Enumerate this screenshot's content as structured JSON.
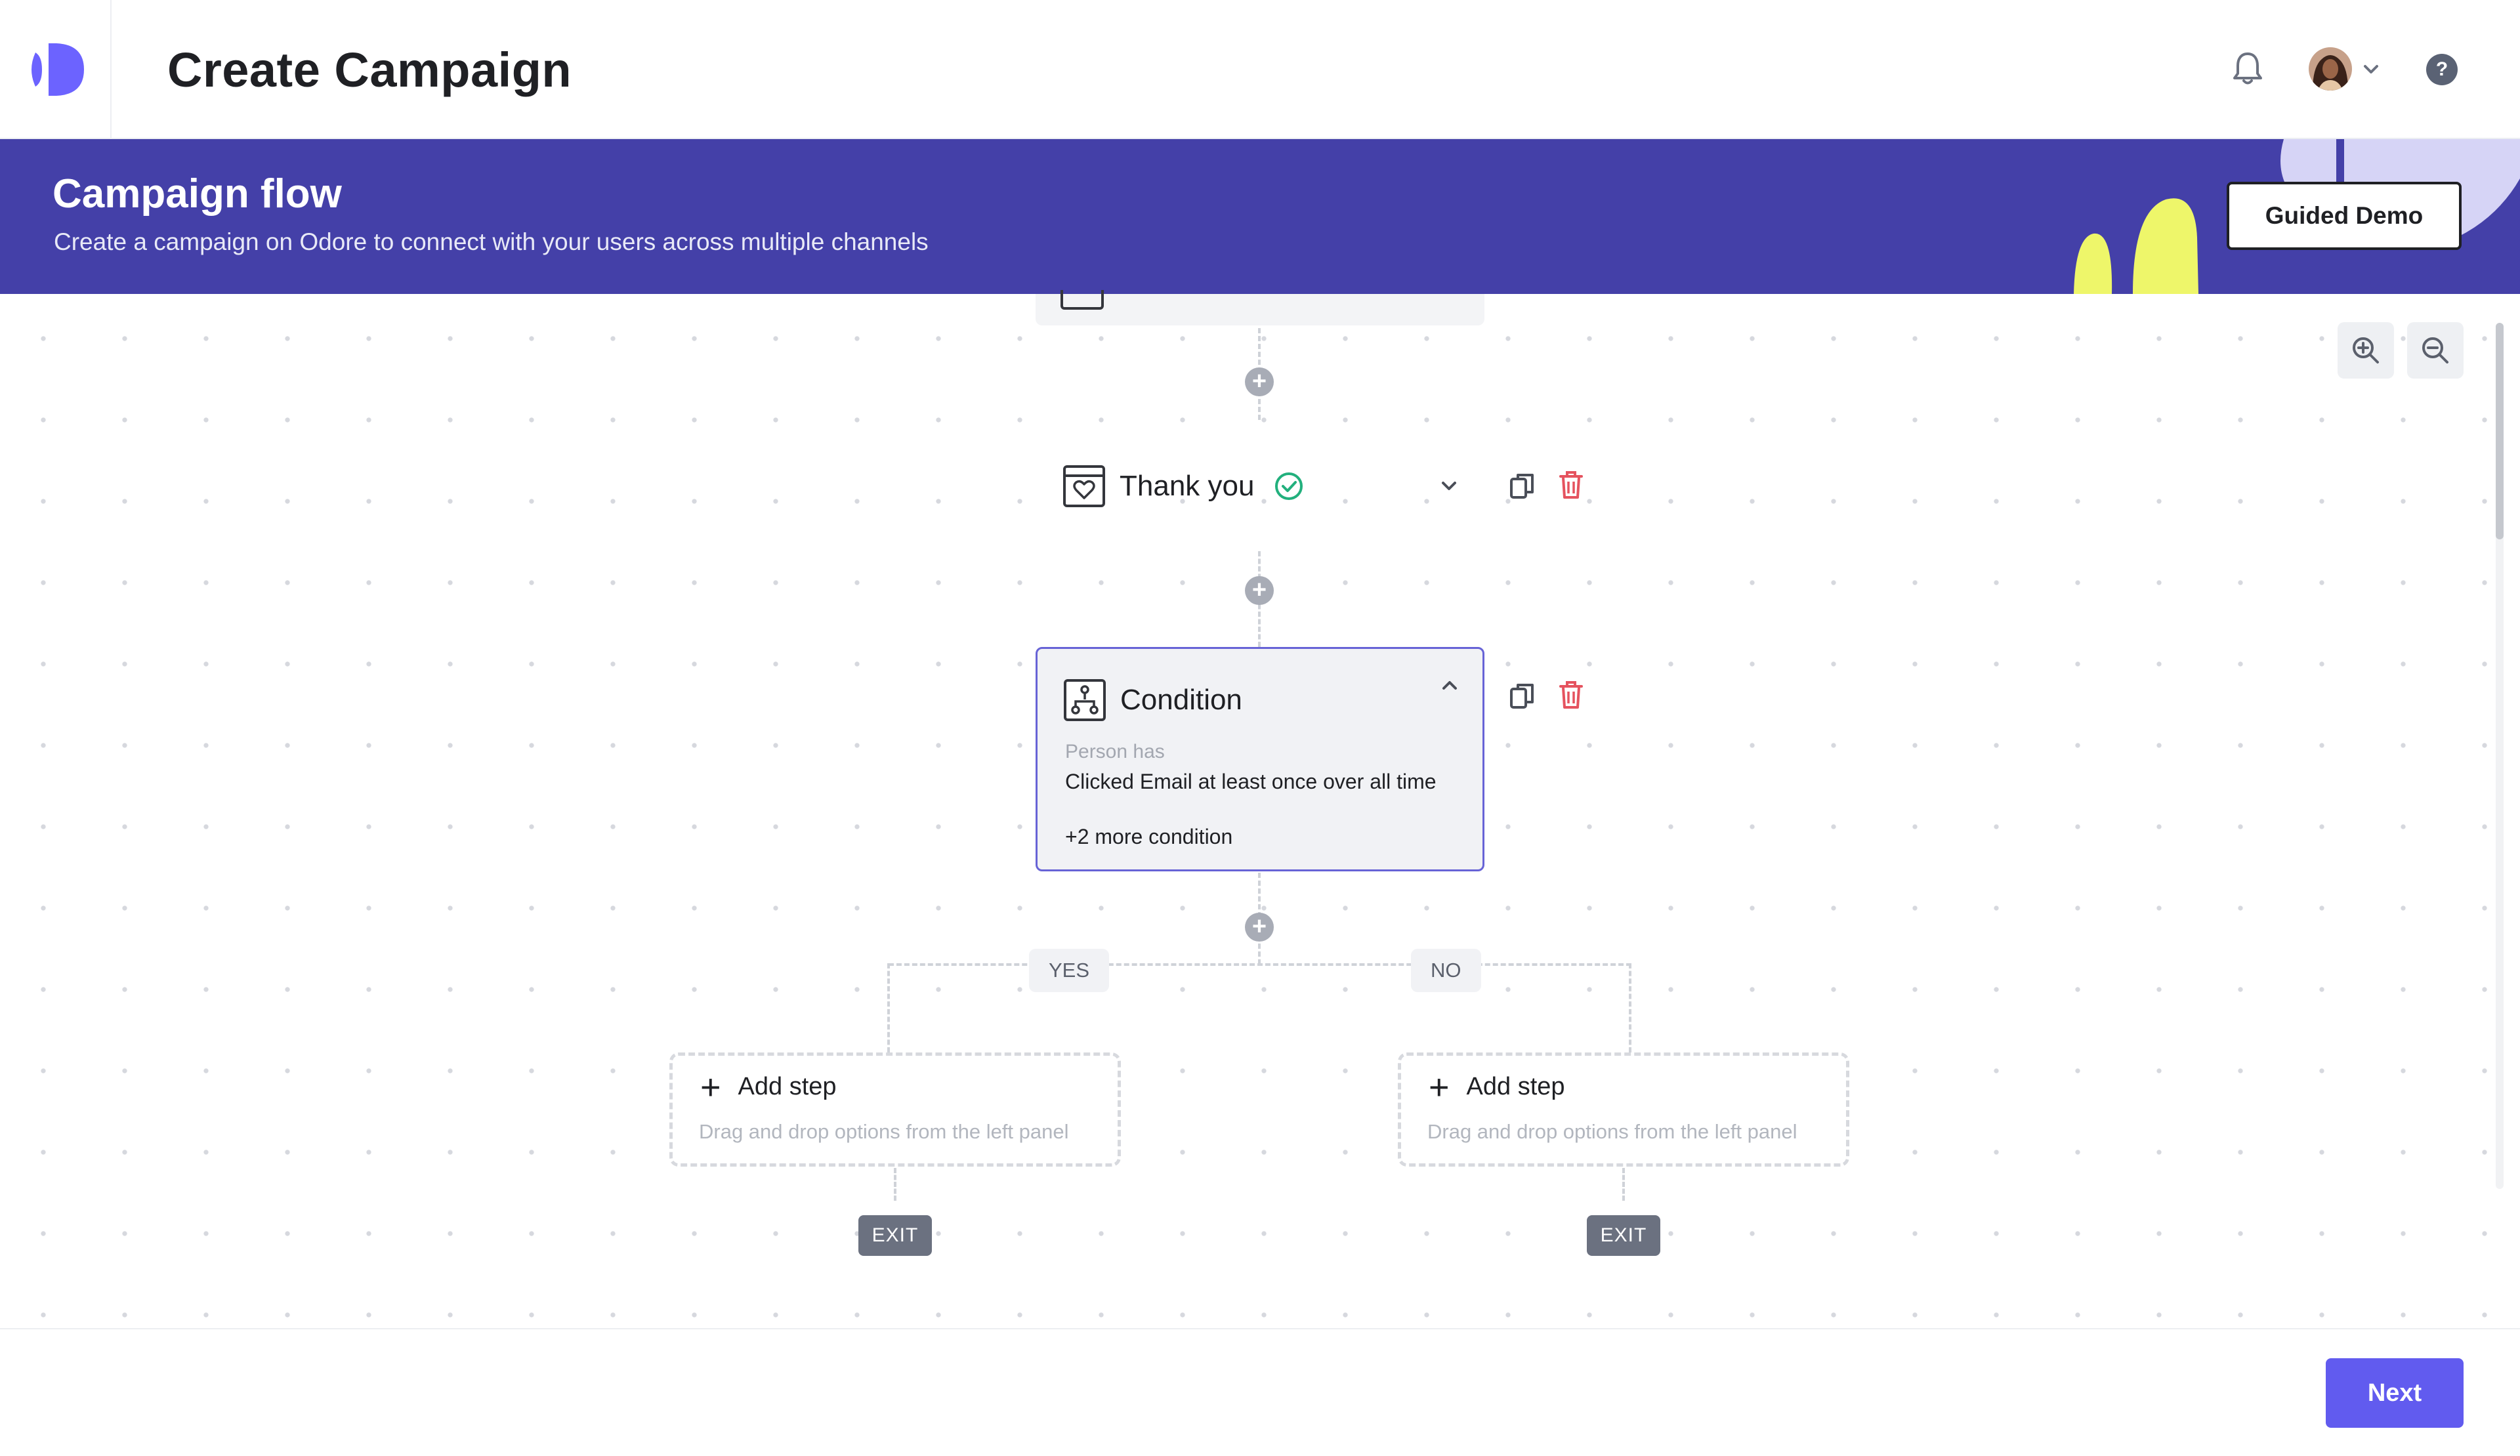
{
  "header": {
    "title": "Create Campaign",
    "icons": [
      "logo",
      "bell-icon",
      "avatar",
      "chevron-down-icon",
      "help-icon"
    ],
    "help_glyph": "?"
  },
  "banner": {
    "title": "Campaign flow",
    "subtitle": "Create a campaign on Odore to connect with your users across multiple channels",
    "guided_demo_label": "Guided Demo",
    "bg_color": "#4440a8",
    "accent_yellow": "#eef66a",
    "accent_lavender": "#d6d4f6"
  },
  "canvas": {
    "zoom_in_icon": "zoom-in-icon",
    "zoom_out_icon": "zoom-out-icon",
    "thank_you_node": {
      "title": "Thank you",
      "icon": "heart-card-icon",
      "status_icon": "check-circle-icon"
    },
    "condition_node": {
      "title": "Condition",
      "icon": "branch-icon",
      "subject": "Person has",
      "rule_event": "Clicked Email",
      "rule_rest": " at least once over all time",
      "more": "+2 more condition"
    },
    "branches": {
      "yes_label": "YES",
      "no_label": "NO"
    },
    "add_step": {
      "title": "Add step",
      "hint": "Drag and drop options from the left panel"
    },
    "exit_label": "EXIT"
  },
  "footer": {
    "next_label": "Next",
    "accent_color": "#615bef"
  }
}
